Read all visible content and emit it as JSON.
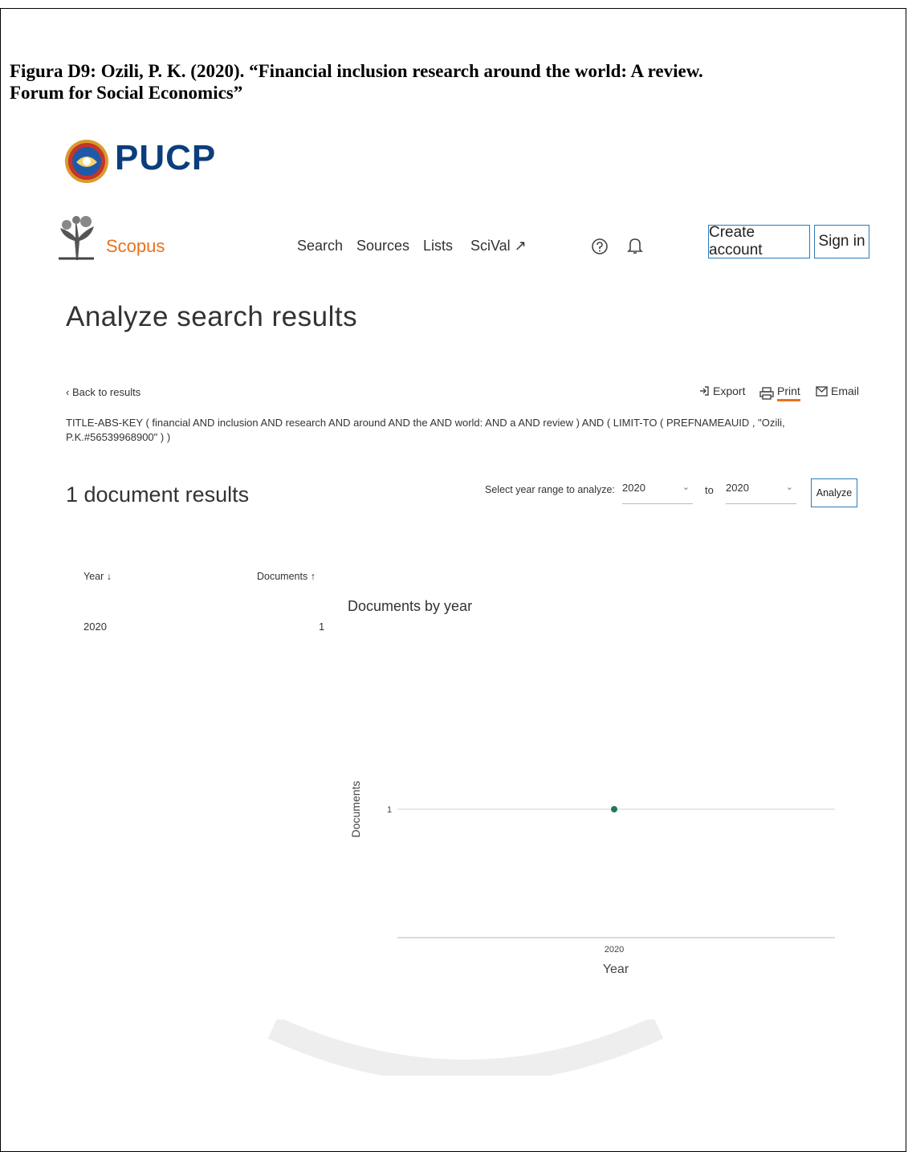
{
  "caption": {
    "line1": "Figura D9: Ozili, P. K. (2020). “Financial inclusion research around the world: A review.",
    "line2": "Forum for Social Economics”"
  },
  "institution": {
    "name": "PUCP",
    "logo_icon": "pucp-shield-icon"
  },
  "header": {
    "brand": "Scopus",
    "nav": [
      "Search",
      "Sources",
      "Lists",
      "SciVal ↗"
    ],
    "help_icon": "help-circle-icon",
    "bell_icon": "bell-icon",
    "create_account": "Create account",
    "sign_in": "Sign in"
  },
  "page": {
    "title": "Analyze search results",
    "back_link": "‹ Back to results",
    "tools": {
      "export": "Export",
      "print": "Print",
      "email": "Email"
    },
    "query": "TITLE-ABS-KEY ( financial AND inclusion AND research AND around AND the AND world: AND a AND review ) AND ( LIMIT-TO ( PREFNAMEAUID , \"Ozili, P.K.#56539968900\" ) )",
    "results_count": "1 document results",
    "range_label": "Select year range to analyze:",
    "from_year": "2020",
    "to_label": "to",
    "to_year": "2020",
    "analyze_button": "Analyze"
  },
  "table": {
    "year_header": "Year ↓",
    "docs_header": "Documents ↑",
    "rows": [
      {
        "year": "2020",
        "docs": "1"
      }
    ]
  },
  "chart_data": {
    "type": "line",
    "title": "Documents by year",
    "xlabel": "Year",
    "ylabel": "Documents",
    "x": [
      "2020"
    ],
    "series": [
      {
        "values": [
          1
        ]
      }
    ],
    "y_ticks": [
      "1"
    ],
    "color": "#1f7a5a",
    "grid": true
  },
  "colors": {
    "accent": "#e9711c",
    "button_border": "#2b7bb9",
    "pucp_blue": "#0b3e7c"
  }
}
